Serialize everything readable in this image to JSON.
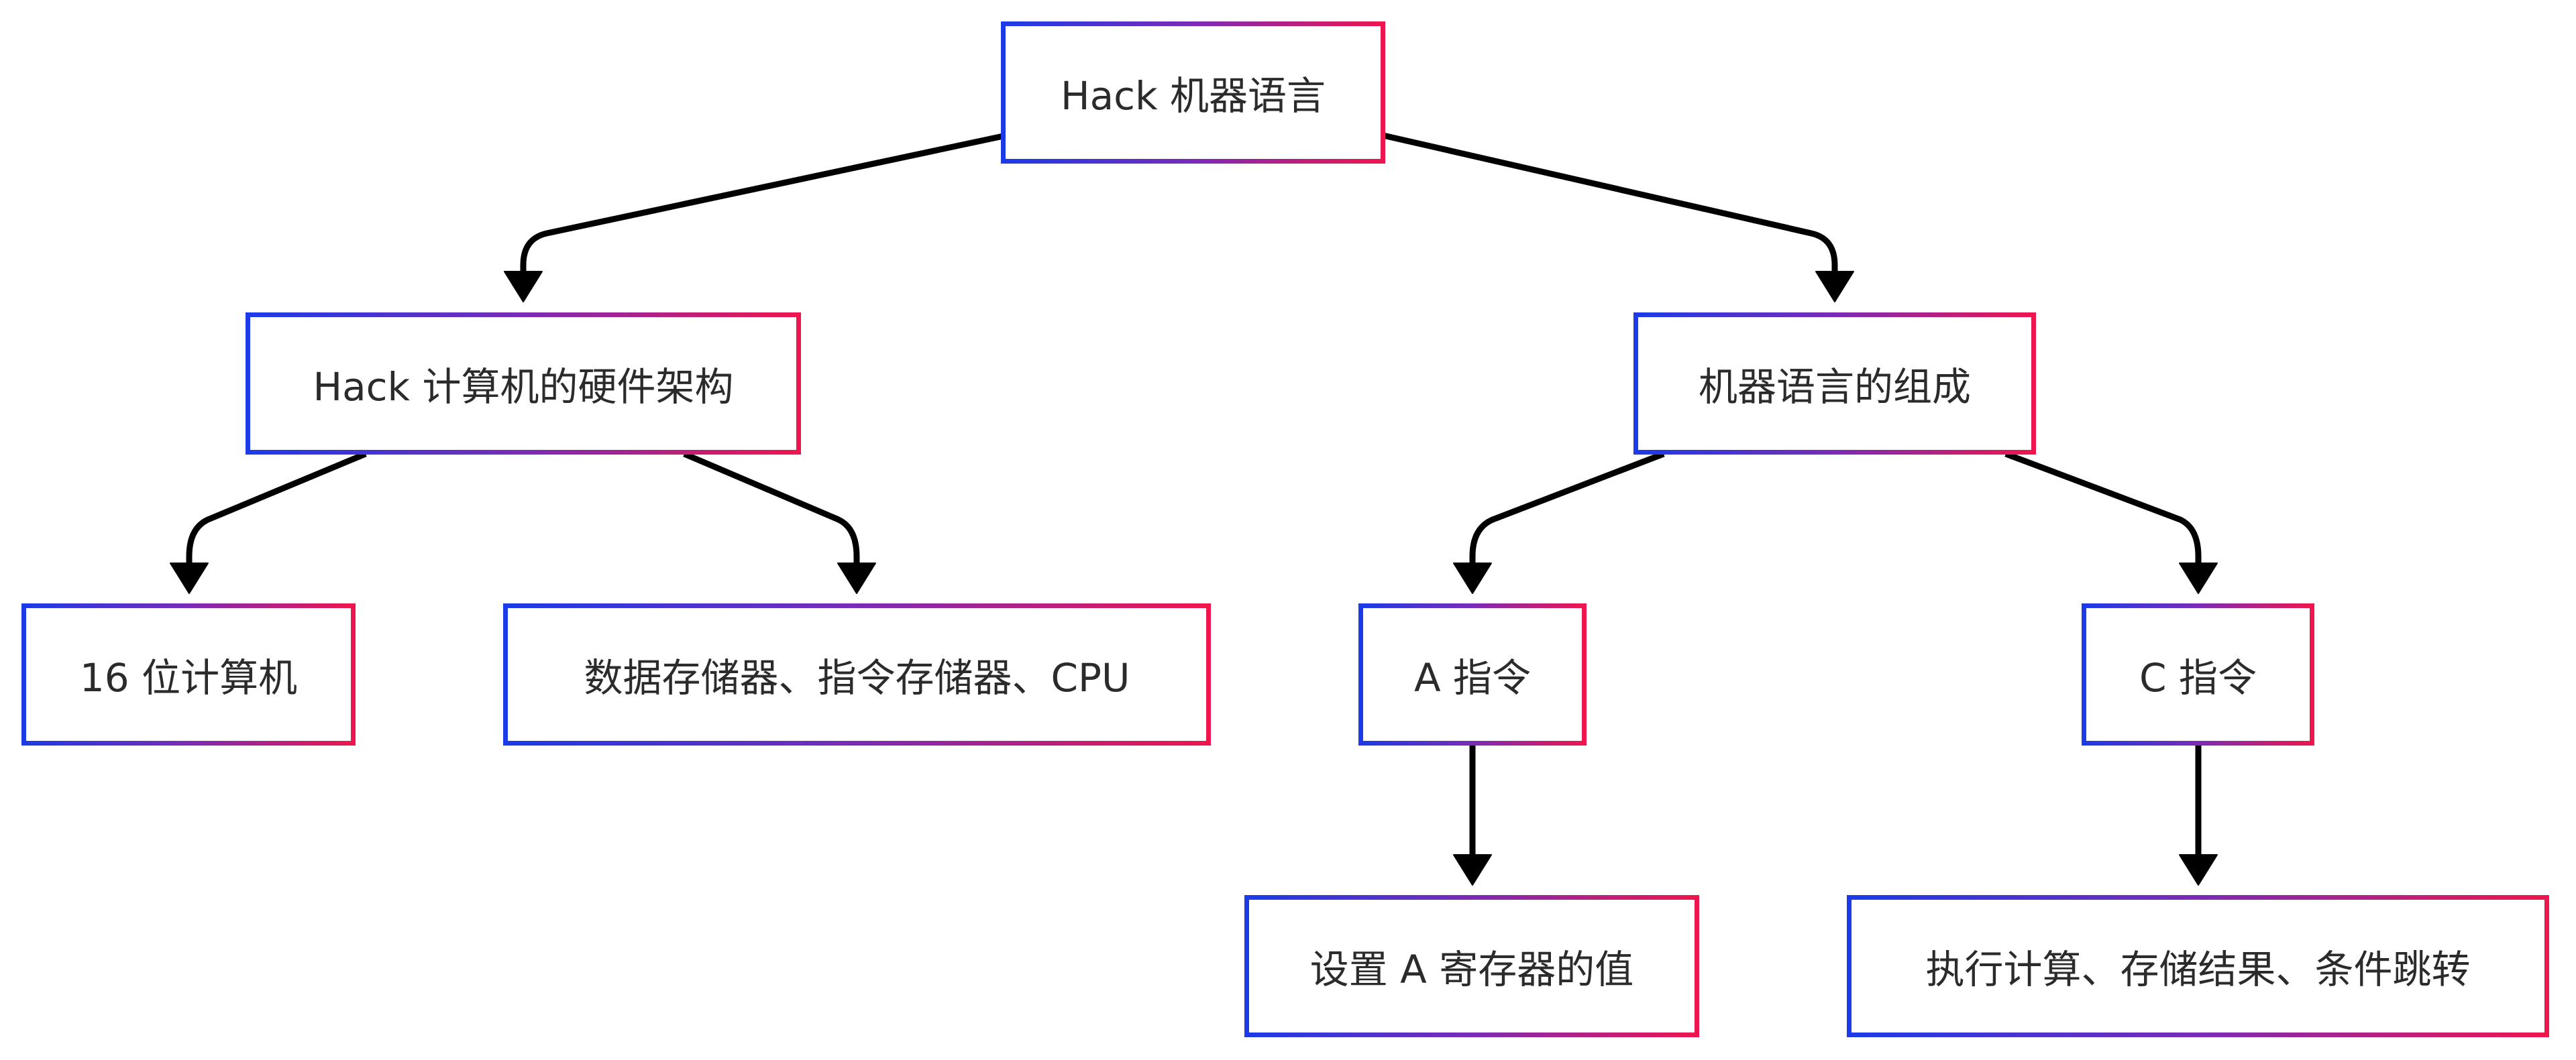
{
  "diagram": {
    "nodes": {
      "root": "Hack 机器语言",
      "hardware": "Hack 计算机的硬件架构",
      "composition": "机器语言的组成",
      "bit16": "16 位计算机",
      "storage": "数据存储器、指令存储器、CPU",
      "a_instr": "A 指令",
      "c_instr": "C 指令",
      "a_desc": "设置 A 寄存器的值",
      "c_desc": "执行计算、存储结果、条件跳转"
    },
    "colors": {
      "border_start": "#1a3be8",
      "border_end": "#f0154d",
      "edge": "#000000",
      "text": "#2b2b2b"
    }
  }
}
